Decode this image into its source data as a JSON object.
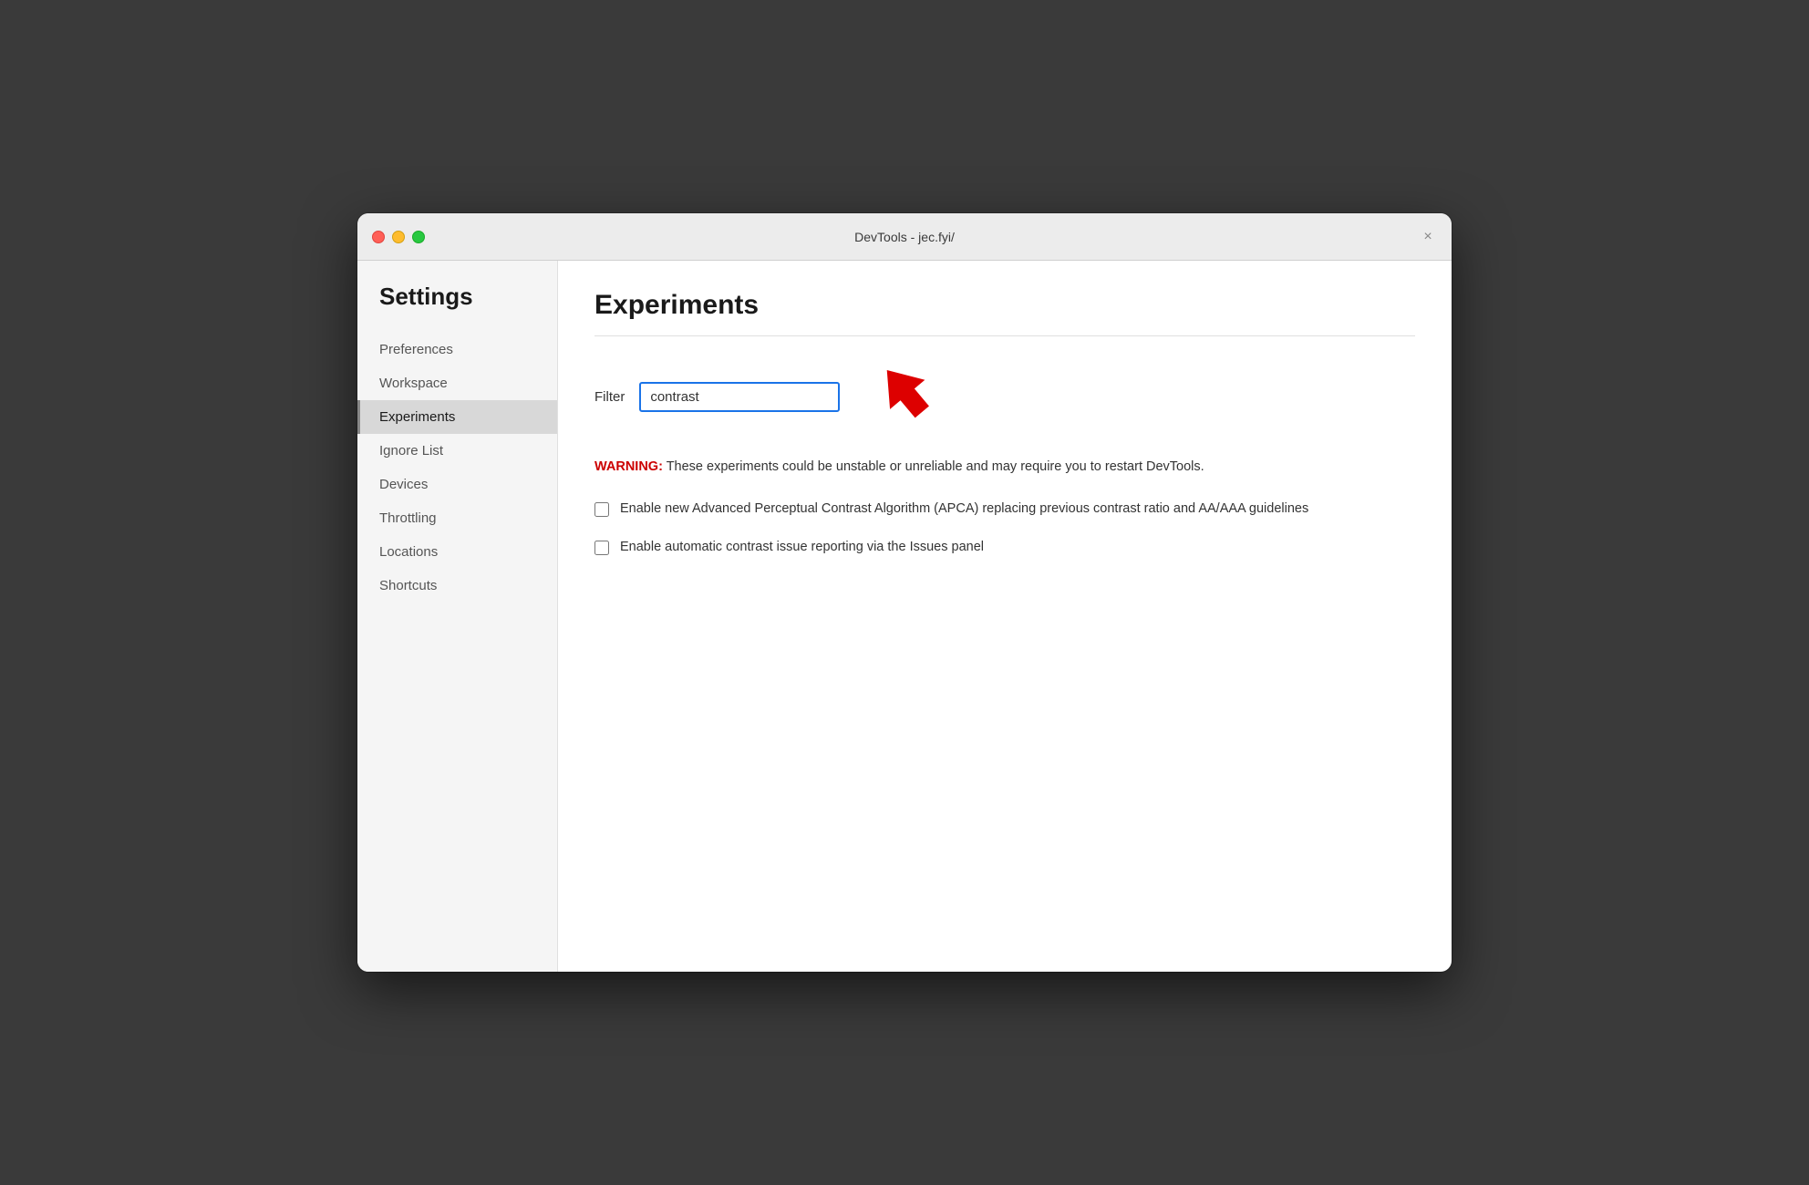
{
  "window": {
    "title": "DevTools - jec.fyi/"
  },
  "titlebar": {
    "close_btn": "×"
  },
  "sidebar": {
    "heading": "Settings",
    "items": [
      {
        "id": "preferences",
        "label": "Preferences",
        "active": false
      },
      {
        "id": "workspace",
        "label": "Workspace",
        "active": false
      },
      {
        "id": "experiments",
        "label": "Experiments",
        "active": true
      },
      {
        "id": "ignore-list",
        "label": "Ignore List",
        "active": false
      },
      {
        "id": "devices",
        "label": "Devices",
        "active": false
      },
      {
        "id": "throttling",
        "label": "Throttling",
        "active": false
      },
      {
        "id": "locations",
        "label": "Locations",
        "active": false
      },
      {
        "id": "shortcuts",
        "label": "Shortcuts",
        "active": false
      }
    ]
  },
  "main": {
    "title": "Experiments",
    "filter": {
      "label": "Filter",
      "value": "contrast"
    },
    "warning": {
      "prefix": "WARNING:",
      "text": " These experiments could be unstable or unreliable and may require you to restart DevTools."
    },
    "checkboxes": [
      {
        "id": "apca",
        "checked": false,
        "label": "Enable new Advanced Perceptual Contrast Algorithm (APCA) replacing previous contrast ratio and AA/AAA guidelines"
      },
      {
        "id": "contrast-reporting",
        "checked": false,
        "label": "Enable automatic contrast issue reporting via the Issues panel"
      }
    ]
  }
}
